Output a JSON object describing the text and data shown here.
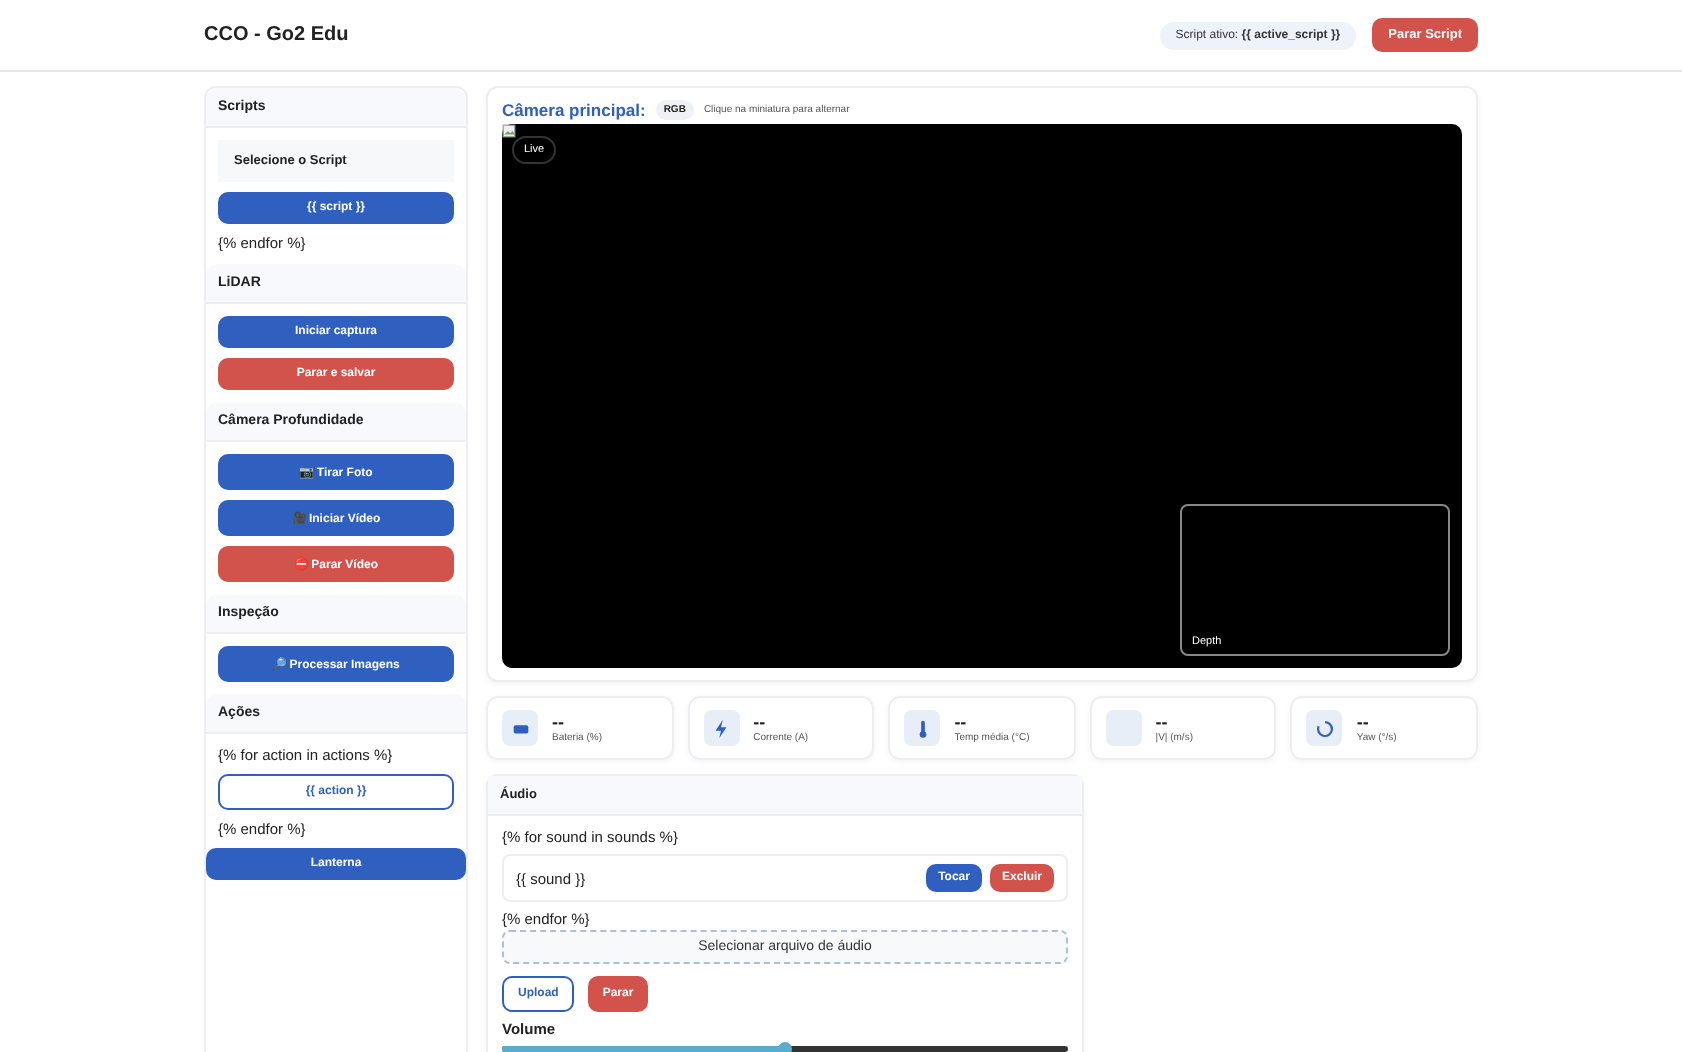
{
  "header": {
    "title": "CCO - Go2 Edu",
    "active_script": "Script ativo: **{{ active_script }}**",
    "stop_button": "Parar Script"
  },
  "sidebar": [
    {
      "title": "Scripts",
      "items": [
        {
          "kind": "select",
          "label": "Selecione o Script"
        },
        {
          "kind": "button",
          "label": "{{ script }}",
          "color": "#2f5fbf"
        },
        {
          "kind": "text",
          "label": "{% endfor %}"
        }
      ]
    },
    {
      "title": "LiDAR",
      "items": [
        {
          "kind": "button",
          "label": "Iniciar captura",
          "color": "#2f5fbf"
        },
        {
          "kind": "button",
          "label": "Parar e salvar",
          "color": "#d2534c"
        }
      ]
    },
    {
      "title": "Câmera Profundidade",
      "items": [
        {
          "kind": "button",
          "label": "📷 Tirar Foto",
          "color": "#2f5fbf"
        },
        {
          "kind": "button",
          "label": "🎥 Iniciar Vídeo",
          "color": "#2f5fbf"
        },
        {
          "kind": "button",
          "label": "⛔ Parar Vídeo",
          "color": "#d2534c"
        }
      ]
    },
    {
      "title": "Inspeção",
      "items": [
        {
          "kind": "button",
          "label": "🔎 Processar Imagens",
          "color": "#2f5fbf"
        }
      ]
    },
    {
      "title": "Ações",
      "items": [
        {
          "kind": "text",
          "label": "{% for action in actions %}"
        },
        {
          "kind": "outline",
          "label": "{{ action }}"
        },
        {
          "kind": "text",
          "label": "{% endfor %}"
        },
        {
          "kind": "wide",
          "label": "Lanterna",
          "color": "#2f5fbf"
        }
      ]
    }
  ],
  "camera": {
    "title": "Câmera principal:",
    "mode": "RGB",
    "hint": "Clique na miniatura para alternar",
    "live": "Live",
    "thumbnail": "Depth"
  },
  "stats": [
    {
      "value": "--",
      "label": "Bateria (%)"
    },
    {
      "value": "--",
      "label": "Corrente (A)"
    },
    {
      "value": "--",
      "label": "Temp média (°C)"
    },
    {
      "value": "--",
      "label": "|V| (m/s)"
    },
    {
      "value": "--",
      "label": "Yaw (°/s)"
    }
  ],
  "audio": {
    "title": "Áudio",
    "loop_start": "{% for sound in sounds %}",
    "sound": "{{ sound }}",
    "play": "Tocar",
    "delete": "Excluir",
    "loop_end": "{% endfor %}",
    "file_button": "Selecionar arquivo de áudio",
    "upload": "Upload",
    "stop": "Parar",
    "volume_label": "Volume",
    "volume": {
      "level": 0.5
    }
  }
}
